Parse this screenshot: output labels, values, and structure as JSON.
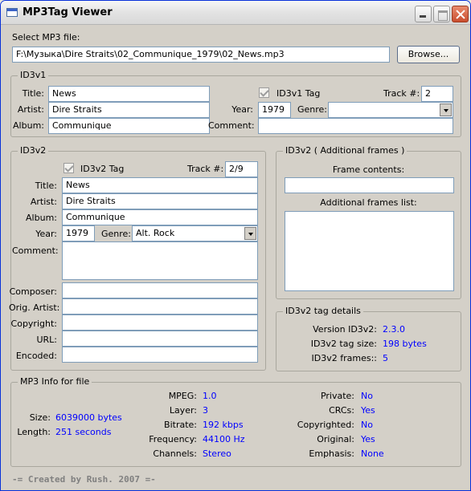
{
  "window": {
    "title": "MP3Tag Viewer"
  },
  "file": {
    "label": "Select MP3 file:",
    "path": "F:\\Музыка\\Dire Straits\\02_Communique_1979\\02_News.mp3",
    "browse": "Browse..."
  },
  "id3v1": {
    "group": "ID3v1",
    "title_label": "Title:",
    "title": "News",
    "artist_label": "Artist:",
    "artist": "Dire Straits",
    "album_label": "Album:",
    "album": "Communique",
    "tag_label": "ID3v1 Tag",
    "track_label": "Track #:",
    "track": "2",
    "year_label": "Year:",
    "year": "1979",
    "genre_label": "Genre:",
    "genre": "",
    "comment_label": "Comment:",
    "comment": ""
  },
  "id3v2": {
    "group": "ID3v2",
    "tag_label": "ID3v2 Tag",
    "track_label": "Track #:",
    "track": "2/9",
    "title_label": "Title:",
    "title": "News",
    "artist_label": "Artist:",
    "artist": "Dire Straits",
    "album_label": "Album:",
    "album": "Communique",
    "year_label": "Year:",
    "year": "1979",
    "genre_label": "Genre:",
    "genre": "Alt. Rock",
    "comment_label": "Comment:",
    "comment": "",
    "composer_label": "Composer:",
    "composer": "",
    "orig_artist_label": "Orig. Artist:",
    "orig_artist": "",
    "copyright_label": "Copyright:",
    "copyright": "",
    "url_label": "URL:",
    "url": "",
    "encoded_label": "Encoded:",
    "encoded": ""
  },
  "additional": {
    "group": "ID3v2 ( Additional frames )",
    "frame_contents_label": "Frame contents:",
    "frame_contents": "",
    "list_label": "Additional frames list:"
  },
  "details": {
    "group": "ID3v2 tag details",
    "version_label": "Version ID3v2:",
    "version": "2.3.0",
    "size_label": "ID3v2 tag size:",
    "size": "198 bytes",
    "frames_label": "ID3v2  frames::",
    "frames": "5"
  },
  "mp3info": {
    "group": "MP3 Info for file",
    "size_label": "Size:",
    "size": "6039000 bytes",
    "length_label": "Length:",
    "length": "251 seconds",
    "mpeg_label": "MPEG:",
    "mpeg": "1.0",
    "layer_label": "Layer:",
    "layer": "3",
    "bitrate_label": "Bitrate:",
    "bitrate": "192 kbps",
    "frequency_label": "Frequency:",
    "frequency": "44100 Hz",
    "channels_label": "Channels:",
    "channels": "Stereo",
    "private_label": "Private:",
    "private": "No",
    "crcs_label": "CRCs:",
    "crcs": "Yes",
    "copyrighted_label": "Copyrighted:",
    "copyrighted": "No",
    "original_label": "Original:",
    "original": "Yes",
    "emphasis_label": "Emphasis:",
    "emphasis": "None"
  },
  "footer": "-= Created by Rush. 2007 =-"
}
